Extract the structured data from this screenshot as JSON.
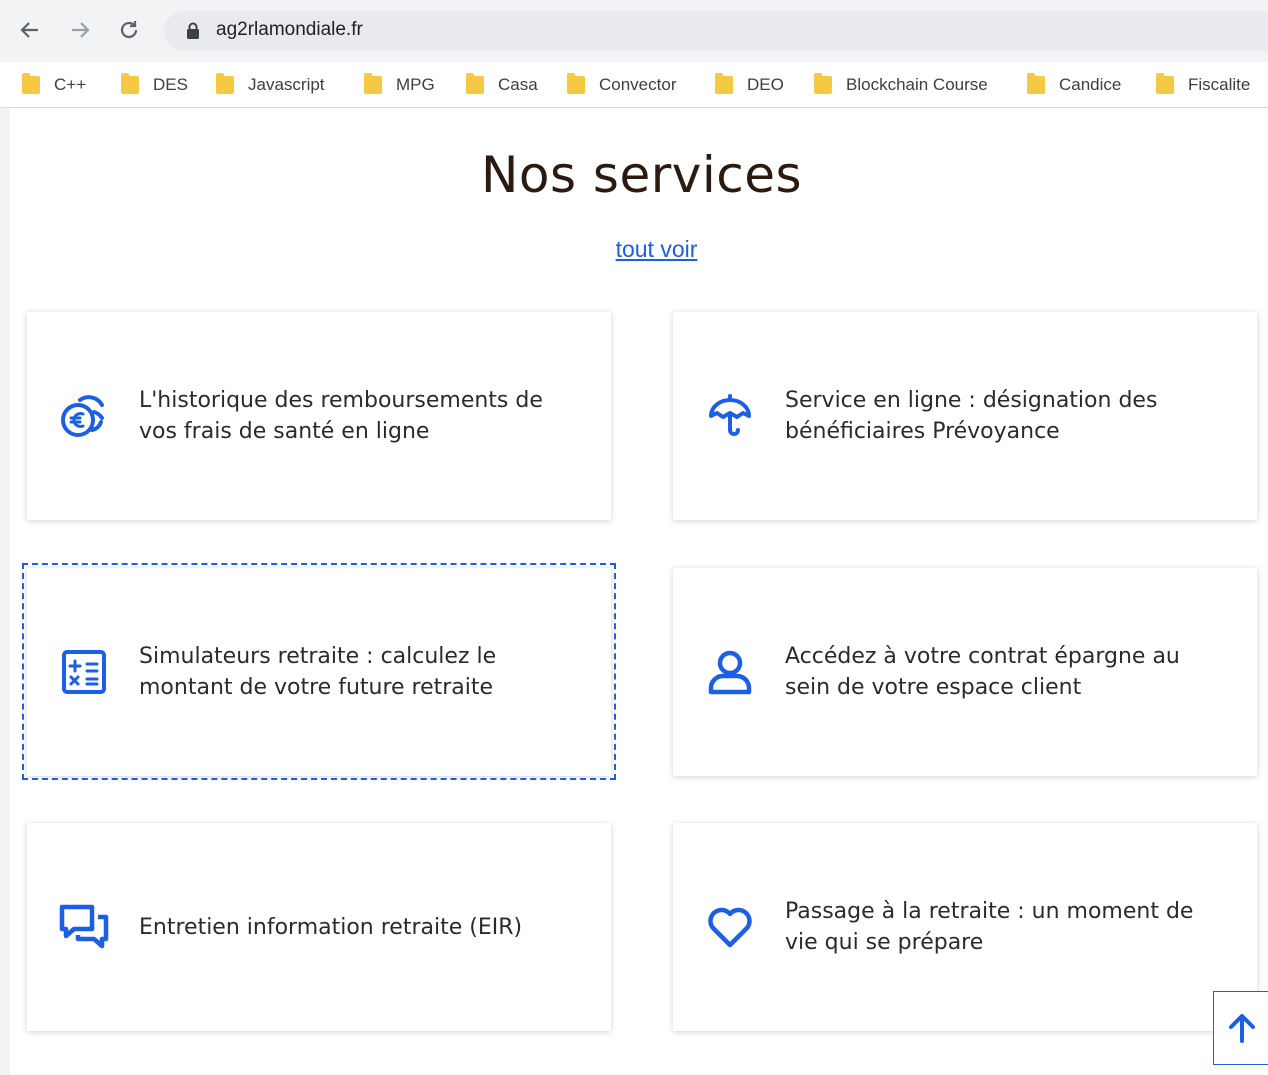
{
  "browser": {
    "url": "ag2rlamondiale.fr",
    "bookmarks": [
      "C++",
      "DES",
      "Javascript",
      "MPG",
      "Casa",
      "Convector",
      "DEO",
      "Blockchain Course",
      "Candice",
      "Fiscalite"
    ]
  },
  "page": {
    "title": "Nos services",
    "see_all": "tout voir"
  },
  "services": [
    {
      "label": "L'historique des remboursements de vos frais de santé en ligne",
      "icon": "euro-coins-icon"
    },
    {
      "label": "Service en ligne : désignation des bénéficiaires Prévoyance",
      "icon": "umbrella-icon"
    },
    {
      "label": "Simulateurs retraite : calculez le montant de votre future retraite",
      "icon": "calculator-icon"
    },
    {
      "label": "Accédez à votre contrat épargne au sein de votre espace client",
      "icon": "user-icon"
    },
    {
      "label": "Entretien information retraite (EIR)",
      "icon": "chat-bubbles-icon"
    },
    {
      "label": "Passage à la retraite : un moment de vie qui se prépare",
      "icon": "heart-icon"
    }
  ],
  "colors": {
    "accent": "#1a5fe6",
    "title": "#2a1a10"
  }
}
